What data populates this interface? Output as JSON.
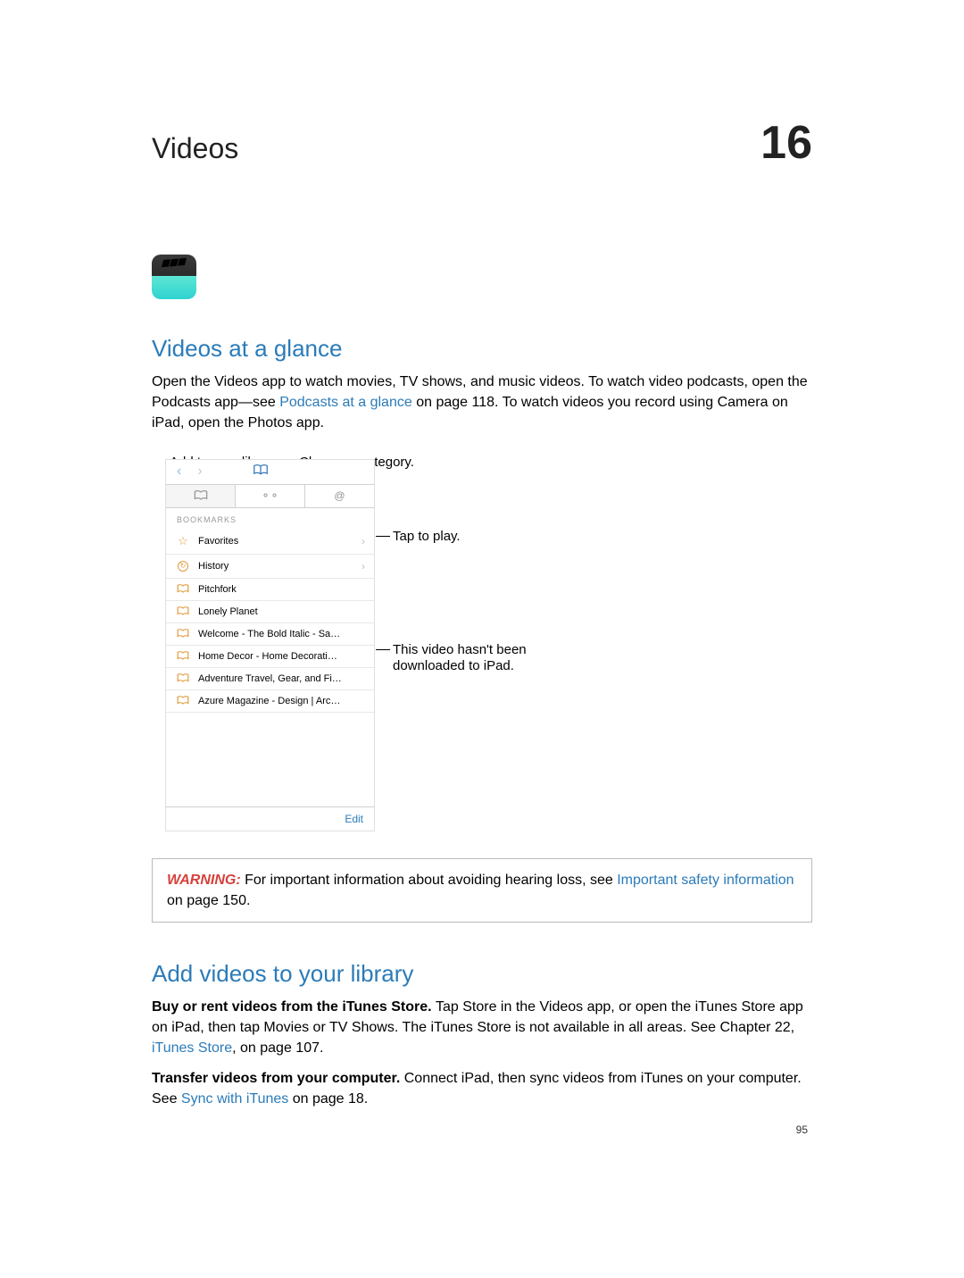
{
  "chapter": {
    "title": "Videos",
    "number": "16"
  },
  "section1": {
    "title": "Videos at a glance",
    "p1_a": "Open the Videos app to watch movies, TV shows, and music videos. To watch video podcasts, open the Podcasts app—see ",
    "p1_link": "Podcasts at a glance",
    "p1_b": " on page 118. To watch videos you record using Camera on iPad, open the Photos app."
  },
  "callouts": {
    "c1": "Add to your library.",
    "c2": "Choose a category.",
    "c3": "Tap to play.",
    "c4a": "This video hasn't been",
    "c4b": "downloaded to iPad."
  },
  "screenshot": {
    "section_label": "BOOKMARKS",
    "items": [
      {
        "icon": "star",
        "label": "Favorites",
        "chevron": true
      },
      {
        "icon": "clock",
        "label": "History",
        "chevron": true
      },
      {
        "icon": "book",
        "label": "Pitchfork",
        "chevron": false
      },
      {
        "icon": "book",
        "label": "Lonely Planet",
        "chevron": false
      },
      {
        "icon": "book",
        "label": "Welcome - The Bold Italic - Sa…",
        "chevron": false
      },
      {
        "icon": "book",
        "label": "Home Decor - Home Decorati…",
        "chevron": false
      },
      {
        "icon": "book",
        "label": "Adventure Travel, Gear, and Fi…",
        "chevron": false
      },
      {
        "icon": "book",
        "label": "Azure Magazine - Design | Arc…",
        "chevron": false
      }
    ],
    "edit_label": "Edit"
  },
  "warning": {
    "label": "WARNING:  ",
    "text_a": "For important information about avoiding hearing loss, see ",
    "link": "Important safety information",
    "text_b": " on page 150."
  },
  "section2": {
    "title": "Add videos to your library",
    "p1_bold": "Buy or rent videos from the iTunes Store. ",
    "p1_a": "Tap Store in the Videos app, or open the iTunes Store app on iPad, then tap Movies or TV Shows. The iTunes Store is not available in all areas. See Chapter 22, ",
    "p1_link": "iTunes Store",
    "p1_b": ", on page 107.",
    "p2_bold": "Transfer videos from your computer. ",
    "p2_a": "Connect iPad, then sync videos from iTunes on your computer. See ",
    "p2_link": "Sync with iTunes",
    "p2_b": " on page 18."
  },
  "page_number": "95"
}
